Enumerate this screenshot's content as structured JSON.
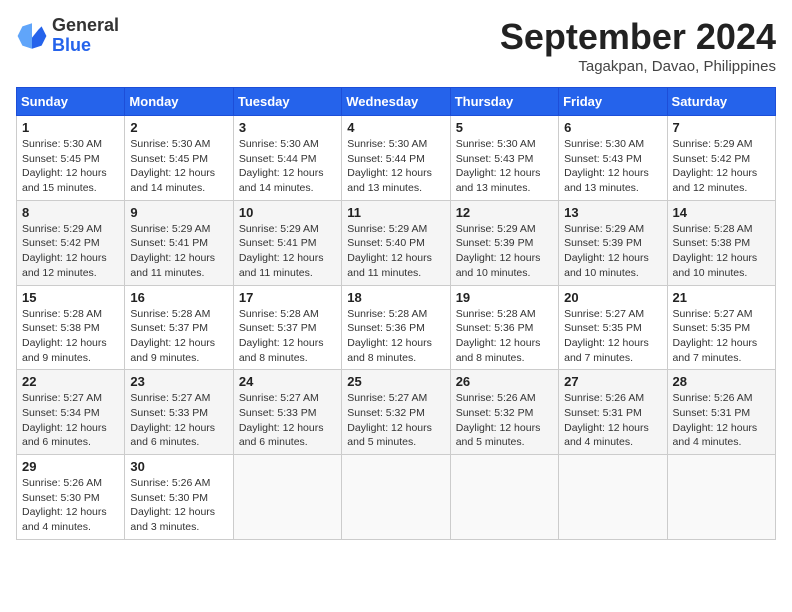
{
  "header": {
    "logo_general": "General",
    "logo_blue": "Blue",
    "month_title": "September 2024",
    "location": "Tagakpan, Davao, Philippines"
  },
  "days_of_week": [
    "Sunday",
    "Monday",
    "Tuesday",
    "Wednesday",
    "Thursday",
    "Friday",
    "Saturday"
  ],
  "weeks": [
    [
      {
        "day": 1,
        "info": "Sunrise: 5:30 AM\nSunset: 5:45 PM\nDaylight: 12 hours\nand 15 minutes."
      },
      {
        "day": 2,
        "info": "Sunrise: 5:30 AM\nSunset: 5:45 PM\nDaylight: 12 hours\nand 14 minutes."
      },
      {
        "day": 3,
        "info": "Sunrise: 5:30 AM\nSunset: 5:44 PM\nDaylight: 12 hours\nand 14 minutes."
      },
      {
        "day": 4,
        "info": "Sunrise: 5:30 AM\nSunset: 5:44 PM\nDaylight: 12 hours\nand 13 minutes."
      },
      {
        "day": 5,
        "info": "Sunrise: 5:30 AM\nSunset: 5:43 PM\nDaylight: 12 hours\nand 13 minutes."
      },
      {
        "day": 6,
        "info": "Sunrise: 5:30 AM\nSunset: 5:43 PM\nDaylight: 12 hours\nand 13 minutes."
      },
      {
        "day": 7,
        "info": "Sunrise: 5:29 AM\nSunset: 5:42 PM\nDaylight: 12 hours\nand 12 minutes."
      }
    ],
    [
      {
        "day": 8,
        "info": "Sunrise: 5:29 AM\nSunset: 5:42 PM\nDaylight: 12 hours\nand 12 minutes."
      },
      {
        "day": 9,
        "info": "Sunrise: 5:29 AM\nSunset: 5:41 PM\nDaylight: 12 hours\nand 11 minutes."
      },
      {
        "day": 10,
        "info": "Sunrise: 5:29 AM\nSunset: 5:41 PM\nDaylight: 12 hours\nand 11 minutes."
      },
      {
        "day": 11,
        "info": "Sunrise: 5:29 AM\nSunset: 5:40 PM\nDaylight: 12 hours\nand 11 minutes."
      },
      {
        "day": 12,
        "info": "Sunrise: 5:29 AM\nSunset: 5:39 PM\nDaylight: 12 hours\nand 10 minutes."
      },
      {
        "day": 13,
        "info": "Sunrise: 5:29 AM\nSunset: 5:39 PM\nDaylight: 12 hours\nand 10 minutes."
      },
      {
        "day": 14,
        "info": "Sunrise: 5:28 AM\nSunset: 5:38 PM\nDaylight: 12 hours\nand 10 minutes."
      }
    ],
    [
      {
        "day": 15,
        "info": "Sunrise: 5:28 AM\nSunset: 5:38 PM\nDaylight: 12 hours\nand 9 minutes."
      },
      {
        "day": 16,
        "info": "Sunrise: 5:28 AM\nSunset: 5:37 PM\nDaylight: 12 hours\nand 9 minutes."
      },
      {
        "day": 17,
        "info": "Sunrise: 5:28 AM\nSunset: 5:37 PM\nDaylight: 12 hours\nand 8 minutes."
      },
      {
        "day": 18,
        "info": "Sunrise: 5:28 AM\nSunset: 5:36 PM\nDaylight: 12 hours\nand 8 minutes."
      },
      {
        "day": 19,
        "info": "Sunrise: 5:28 AM\nSunset: 5:36 PM\nDaylight: 12 hours\nand 8 minutes."
      },
      {
        "day": 20,
        "info": "Sunrise: 5:27 AM\nSunset: 5:35 PM\nDaylight: 12 hours\nand 7 minutes."
      },
      {
        "day": 21,
        "info": "Sunrise: 5:27 AM\nSunset: 5:35 PM\nDaylight: 12 hours\nand 7 minutes."
      }
    ],
    [
      {
        "day": 22,
        "info": "Sunrise: 5:27 AM\nSunset: 5:34 PM\nDaylight: 12 hours\nand 6 minutes."
      },
      {
        "day": 23,
        "info": "Sunrise: 5:27 AM\nSunset: 5:33 PM\nDaylight: 12 hours\nand 6 minutes."
      },
      {
        "day": 24,
        "info": "Sunrise: 5:27 AM\nSunset: 5:33 PM\nDaylight: 12 hours\nand 6 minutes."
      },
      {
        "day": 25,
        "info": "Sunrise: 5:27 AM\nSunset: 5:32 PM\nDaylight: 12 hours\nand 5 minutes."
      },
      {
        "day": 26,
        "info": "Sunrise: 5:26 AM\nSunset: 5:32 PM\nDaylight: 12 hours\nand 5 minutes."
      },
      {
        "day": 27,
        "info": "Sunrise: 5:26 AM\nSunset: 5:31 PM\nDaylight: 12 hours\nand 4 minutes."
      },
      {
        "day": 28,
        "info": "Sunrise: 5:26 AM\nSunset: 5:31 PM\nDaylight: 12 hours\nand 4 minutes."
      }
    ],
    [
      {
        "day": 29,
        "info": "Sunrise: 5:26 AM\nSunset: 5:30 PM\nDaylight: 12 hours\nand 4 minutes."
      },
      {
        "day": 30,
        "info": "Sunrise: 5:26 AM\nSunset: 5:30 PM\nDaylight: 12 hours\nand 3 minutes."
      },
      {
        "day": null,
        "info": ""
      },
      {
        "day": null,
        "info": ""
      },
      {
        "day": null,
        "info": ""
      },
      {
        "day": null,
        "info": ""
      },
      {
        "day": null,
        "info": ""
      }
    ]
  ]
}
